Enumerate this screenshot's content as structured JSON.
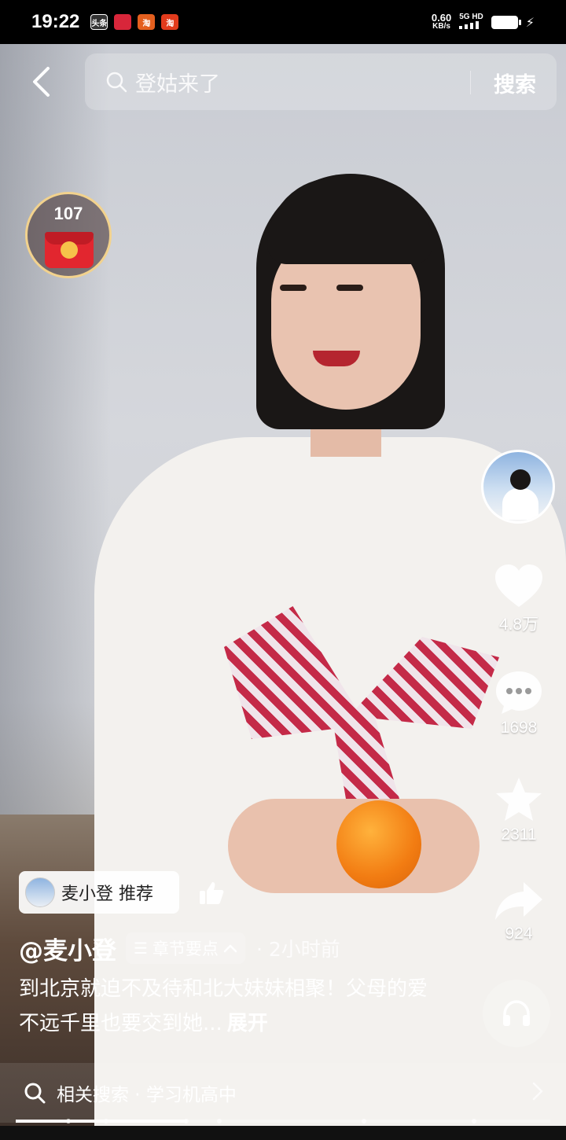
{
  "status_bar": {
    "time": "19:22",
    "app_icons": [
      {
        "name": "toutiao-app-icon",
        "text": "头条",
        "color": "#ffffff",
        "bg": "#333333"
      },
      {
        "name": "app-icon-red-1",
        "text": "",
        "color": "#ffffff",
        "bg": "#d8263a"
      },
      {
        "name": "taobao-app-icon-1",
        "text": "淘",
        "color": "#ffffff",
        "bg": "#e45f1e"
      },
      {
        "name": "taobao-app-icon-2",
        "text": "淘",
        "color": "#ffffff",
        "bg": "#e23b1c"
      }
    ],
    "net_speed_value": "0.60",
    "net_speed_unit": "KB/s",
    "network": "5G HD"
  },
  "search": {
    "placeholder": "登姑来了",
    "button_label": "搜索"
  },
  "envelope": {
    "count": "107"
  },
  "actions": {
    "likes": "4.8万",
    "comments": "1698",
    "favorites": "2311",
    "shares": "924"
  },
  "recommend": {
    "label": "麦小登 推荐"
  },
  "post": {
    "author": "@麦小登",
    "chapter_label": "章节要点",
    "time_ago": "· 2小时前",
    "description": "到北京就迫不及待和北大妹妹相聚！父母的爱不远千里也要交到她...",
    "expand_label": "展开"
  },
  "related": {
    "label": "相关搜索 · 学习机高中"
  },
  "playback": {
    "progress": 0.32
  },
  "colors": {
    "like": "#ffffff",
    "envelope_red": "#e2262f",
    "envelope_gold": "#f2d28d"
  }
}
